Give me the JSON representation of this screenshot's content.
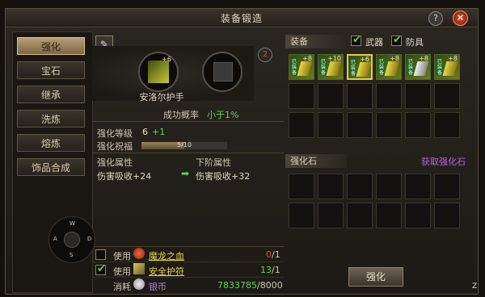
{
  "window": {
    "title": "装备锻造",
    "help_label": "?",
    "close_label": "✕"
  },
  "sidebar": {
    "tabs": [
      {
        "label": "强化",
        "active": true
      },
      {
        "label": "宝石"
      },
      {
        "label": "继承"
      },
      {
        "label": "洗炼"
      },
      {
        "label": "熔炼"
      },
      {
        "label": "饰品合成"
      }
    ]
  },
  "compass": {
    "n": "W",
    "w": "A",
    "e": "D",
    "s": "S"
  },
  "enhance": {
    "item_level": "+6",
    "item_name": "安洛尔护手",
    "badge": "2",
    "success_label": "成功概率",
    "success_value": "小于1%",
    "level_label": "强化等级",
    "level_value": "6",
    "level_plus": "+1",
    "bless_label": "强化祝福",
    "bless_value": "5/10",
    "bless_fraction": 0.5,
    "attr_label": "强化属性",
    "next_label": "下阶属性",
    "attr_current": "伤害吸收+24",
    "attr_next": "伤害吸收+32"
  },
  "materials": [
    {
      "use": "使用",
      "checked": false,
      "name": "魔龙之血",
      "have": "0",
      "need": "/1"
    },
    {
      "use": "使用",
      "checked": true,
      "name": "安全护符",
      "have": "13",
      "need": "/1"
    }
  ],
  "cost": {
    "label": "消耗",
    "currency": "银币",
    "have": "7833785",
    "need": "/8000"
  },
  "equip": {
    "header": "装备",
    "filter_weapon": "武器",
    "filter_armor": "防具",
    "items": [
      {
        "plus": "+8",
        "tag": "已装备"
      },
      {
        "plus": "+10",
        "tag": "已装备"
      },
      {
        "plus": "+6",
        "tag": "已装备",
        "selected": true
      },
      {
        "plus": "+8",
        "tag": "已装备"
      },
      {
        "plus": "+8",
        "tag": "已装备"
      },
      {
        "plus": "+8",
        "tag": "已装备"
      }
    ]
  },
  "stones": {
    "header": "强化石",
    "link": "获取强化石"
  },
  "action": {
    "enhance_button": "强化"
  },
  "corner": "Z"
}
